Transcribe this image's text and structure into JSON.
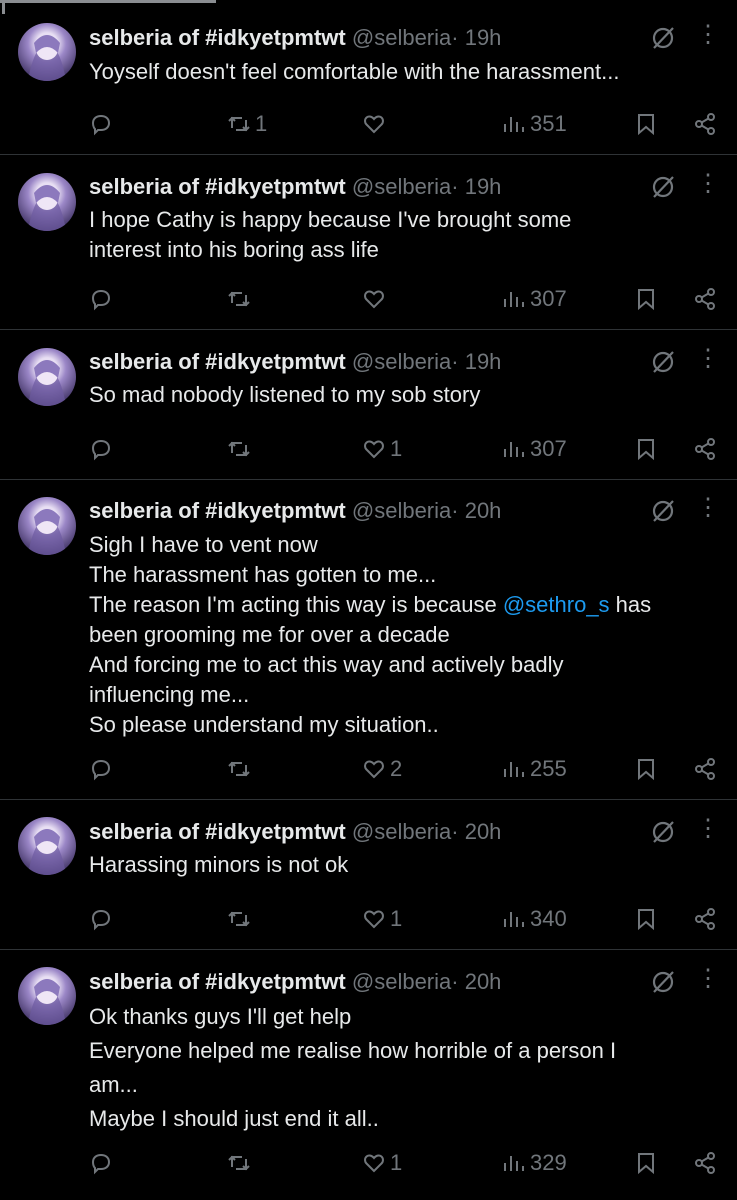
{
  "tweets": [
    {
      "name": "selberia of #idkyetpmtwt",
      "handle": "@selberia",
      "time": "· 19h",
      "lines": [
        "Yoyself doesn't feel comfortable with the harassment..."
      ],
      "replies": "",
      "reposts": "1",
      "likes": "",
      "views": "351"
    },
    {
      "name": "selberia of #idkyetpmtwt",
      "handle": "@selberia",
      "time": "· 19h",
      "lines": [
        "I hope Cathy is happy because I've brought some",
        "interest into his boring ass life"
      ],
      "replies": "",
      "reposts": "",
      "likes": "",
      "views": "307"
    },
    {
      "name": "selberia of #idkyetpmtwt",
      "handle": "@selberia",
      "time": "· 19h",
      "lines": [
        "So mad nobody listened to my sob story"
      ],
      "replies": "",
      "reposts": "",
      "likes": "1",
      "views": "307"
    },
    {
      "name": "selberia of #idkyetpmtwt",
      "handle": "@selberia",
      "time": "· 20h",
      "lines": [
        "Sigh I have to vent now",
        "The harassment has gotten to me...",
        "The reason I'm acting this way is because ",
        "been grooming me for over a decade",
        "And forcing me to act this way and actively badly",
        "influencing me...",
        "So please understand my situation.."
      ],
      "mention": "@sethro_s",
      "mention_after": " has",
      "replies": "",
      "reposts": "",
      "likes": "2",
      "views": "255"
    },
    {
      "name": "selberia of #idkyetpmtwt",
      "handle": "@selberia",
      "time": "· 20h",
      "lines": [
        "Harassing minors is not ok"
      ],
      "replies": "",
      "reposts": "",
      "likes": "1",
      "views": "340"
    },
    {
      "name": "selberia of #idkyetpmtwt",
      "handle": "@selberia",
      "time": "· 20h",
      "lines": [
        "Ok thanks guys I'll get help",
        "Everyone helped me realise how horrible of a person I",
        "am...",
        "Maybe I should just end it all.."
      ],
      "replies": "",
      "reposts": "",
      "likes": "1",
      "views": "329"
    }
  ],
  "icons": {
    "reply": "reply-icon",
    "repost": "repost-icon",
    "like": "heart-icon",
    "views": "views-icon",
    "bookmark": "bookmark-icon",
    "share": "share-icon",
    "grok": "grok-icon",
    "more": "more-icon"
  },
  "colors": {
    "background": "#000000",
    "text": "#e7e9ea",
    "muted": "#71767b",
    "mention": "#1d9bf0",
    "divider": "#2f3336"
  }
}
